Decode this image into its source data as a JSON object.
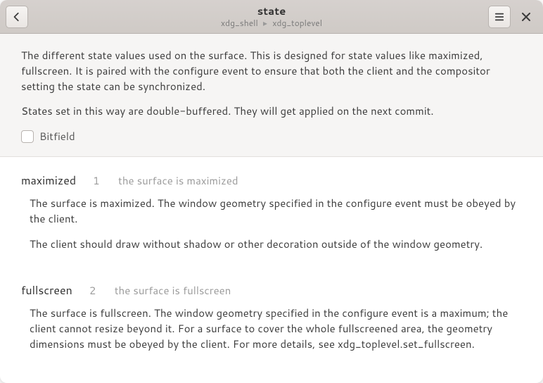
{
  "header": {
    "title": "state",
    "breadcrumb_a": "xdg_shell",
    "breadcrumb_b": "xdg_toplevel"
  },
  "intro": {
    "p1": "The different state values used on the surface. This is designed for state values like maximized, fullscreen. It is paired with the configure event to ensure that both the client and the compositor setting the state can be synchronized.",
    "p2": "States set in this way are double-buffered. They will get applied on the next commit.",
    "bitfield_label": "Bitfield"
  },
  "entries": [
    {
      "name": "maximized",
      "value": "1",
      "summary": "the surface is maximized",
      "desc": [
        "The surface is maximized. The window geometry specified in the configure   event must be obeyed by the client.",
        "The client should draw without shadow or other   decoration outside of the window geometry."
      ]
    },
    {
      "name": "fullscreen",
      "value": "2",
      "summary": "the surface is fullscreen",
      "desc": [
        "The surface is fullscreen. The window geometry specified in the   configure event is a maximum; the client cannot resize beyond it. For   a surface to cover the whole fullscreened area, the geometry   dimensions must be obeyed by the client. For more details, see   xdg_toplevel.set_fullscreen."
      ]
    }
  ]
}
